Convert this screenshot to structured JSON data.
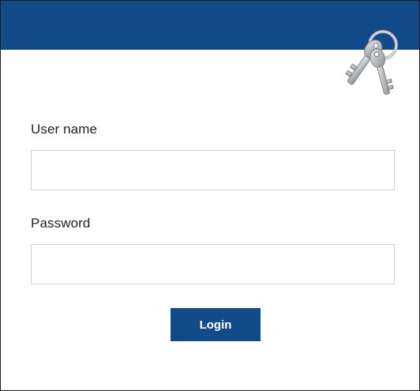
{
  "form": {
    "username_label": "User name",
    "username_value": "",
    "username_placeholder": "",
    "password_label": "Password",
    "password_value": "",
    "password_placeholder": "",
    "login_label": "Login"
  },
  "icons": {
    "header_icon": "keys-icon"
  },
  "colors": {
    "accent": "#134a89",
    "field_border": "#cfd3d6",
    "text": "#1f1f1f",
    "button_text": "#ffffff"
  }
}
